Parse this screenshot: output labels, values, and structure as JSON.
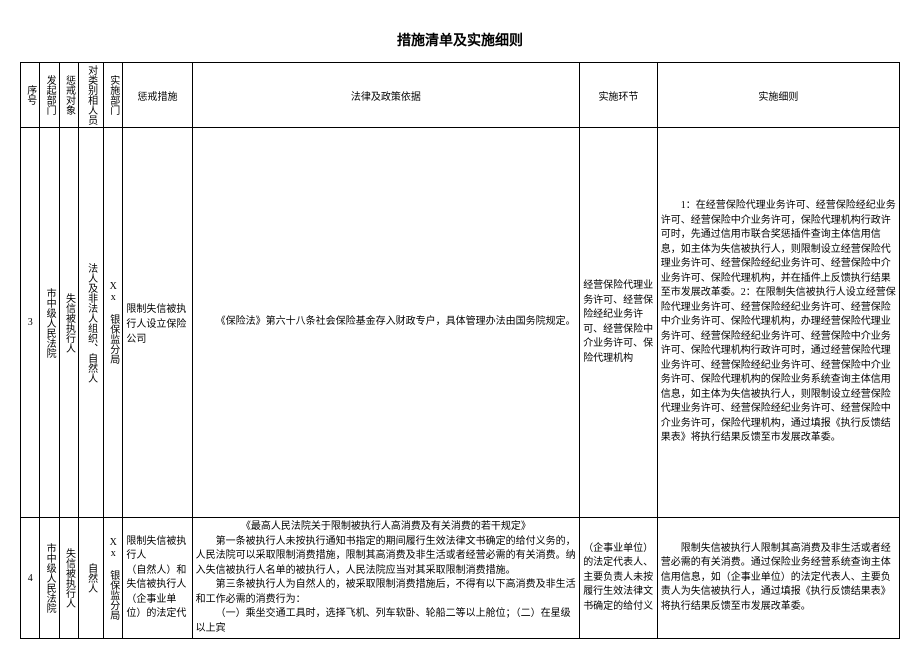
{
  "title": "措施清单及实施细则",
  "headers": {
    "seq": "序号",
    "dept1": "发起部门",
    "target": "惩戒对象",
    "category": "对类别相人员",
    "dept2": "实施部门",
    "measure": "惩戒措施",
    "basis": "法律及政策依据",
    "link": "实施环节",
    "detail": "实施细则"
  },
  "rows": [
    {
      "seq": "3",
      "dept1": "市中级人民法院",
      "target": "失信被执行人",
      "category": "法人及非法人组织、自然人",
      "dept2": "Xx 银保监分局",
      "measure": "限制失信被执行人设立保险公司",
      "basis": "《保险法》第六十八条社会保险基金存入财政专户，具体管理办法由国务院规定。",
      "link": "经营保险代理业务许可、经营保险经纪业务许可、经营保险中介业务许可、保险代理机构",
      "detail_p1": "1：在经营保险代理业务许可、经营保险经纪业务许可、经营保险中介业务许可，保险代理机构行政许可时，先通过信用市联合奖惩插件查询主体信用信息，如主体为失信被执行人，则限制设立经营保险代理业务许可、经营保险经纪业务许可、经营保险中介业务许可、保险代理机构，并在插件上反馈执行结果至市发展改革委。2：在限制失信被执行人设立经营保险代理业务许可、经营保险经纪业务许可、经营保险中介业务许可、保险代理机构，办理经营保险代理业务许可、经营保险经纪业务许可、经营保险中介业务许可、保险代理机构行政许可时，通过经营保险代理业务许可、经营保险经纪业务许可、经营保险中介业务许可、保险代理机构的保险业务系统查询主体信用信息，如主体为失信被执行人，则限制设立经营保险代理业务许可、经营保险经纪业务许可、经营保险中介业务许可，保险代理机构，通过填报《执行反馈结果表》将执行结果反馈至市发展改革委。"
    },
    {
      "seq": "4",
      "dept1": "市中级人民法院",
      "target": "失信被执行人",
      "category": "自然人",
      "dept2": "Xx 银保监分局",
      "measure_l1": "限制失信被执行人",
      "measure_l2": "（自然人）和失信被执行人（企事业单位）的法定代",
      "basis_title": "《最高人民法院关于限制被执行人高消费及有关消费的若干规定》",
      "basis_p1": "第一条被执行人未按执行通知书指定的期间履行生效法律文书确定的给付义务的，人民法院可以采取限制消费措施，限制其高消费及非生活或者经营必需的有关消费。纳入失信被执行人名单的被执行人，人民法院应当对其采取限制消费措施。",
      "basis_p2": "第三条被执行人为自然人的，被采取限制消费措施后，不得有以下高消费及非生活和工作必需的消费行为：",
      "basis_p3": "（一）乘坐交通工具时，选择飞机、列车软卧、轮船二等以上舱位；（二）在星级以上宾",
      "link": "（企事业单位）的法定代表人、主要负责人未按履行生效法律文书确定的给付义",
      "detail": "限制失信被执行人限制其高消费及非生活或者经营必需的有关消费。通过保险业务经营系统查询主体信用信息，如（企事业单位）的法定代表人、主要负责人为失信被执行人，通过填报《执行反馈结果表》将执行结果反馈至市发展改革委。"
    }
  ]
}
